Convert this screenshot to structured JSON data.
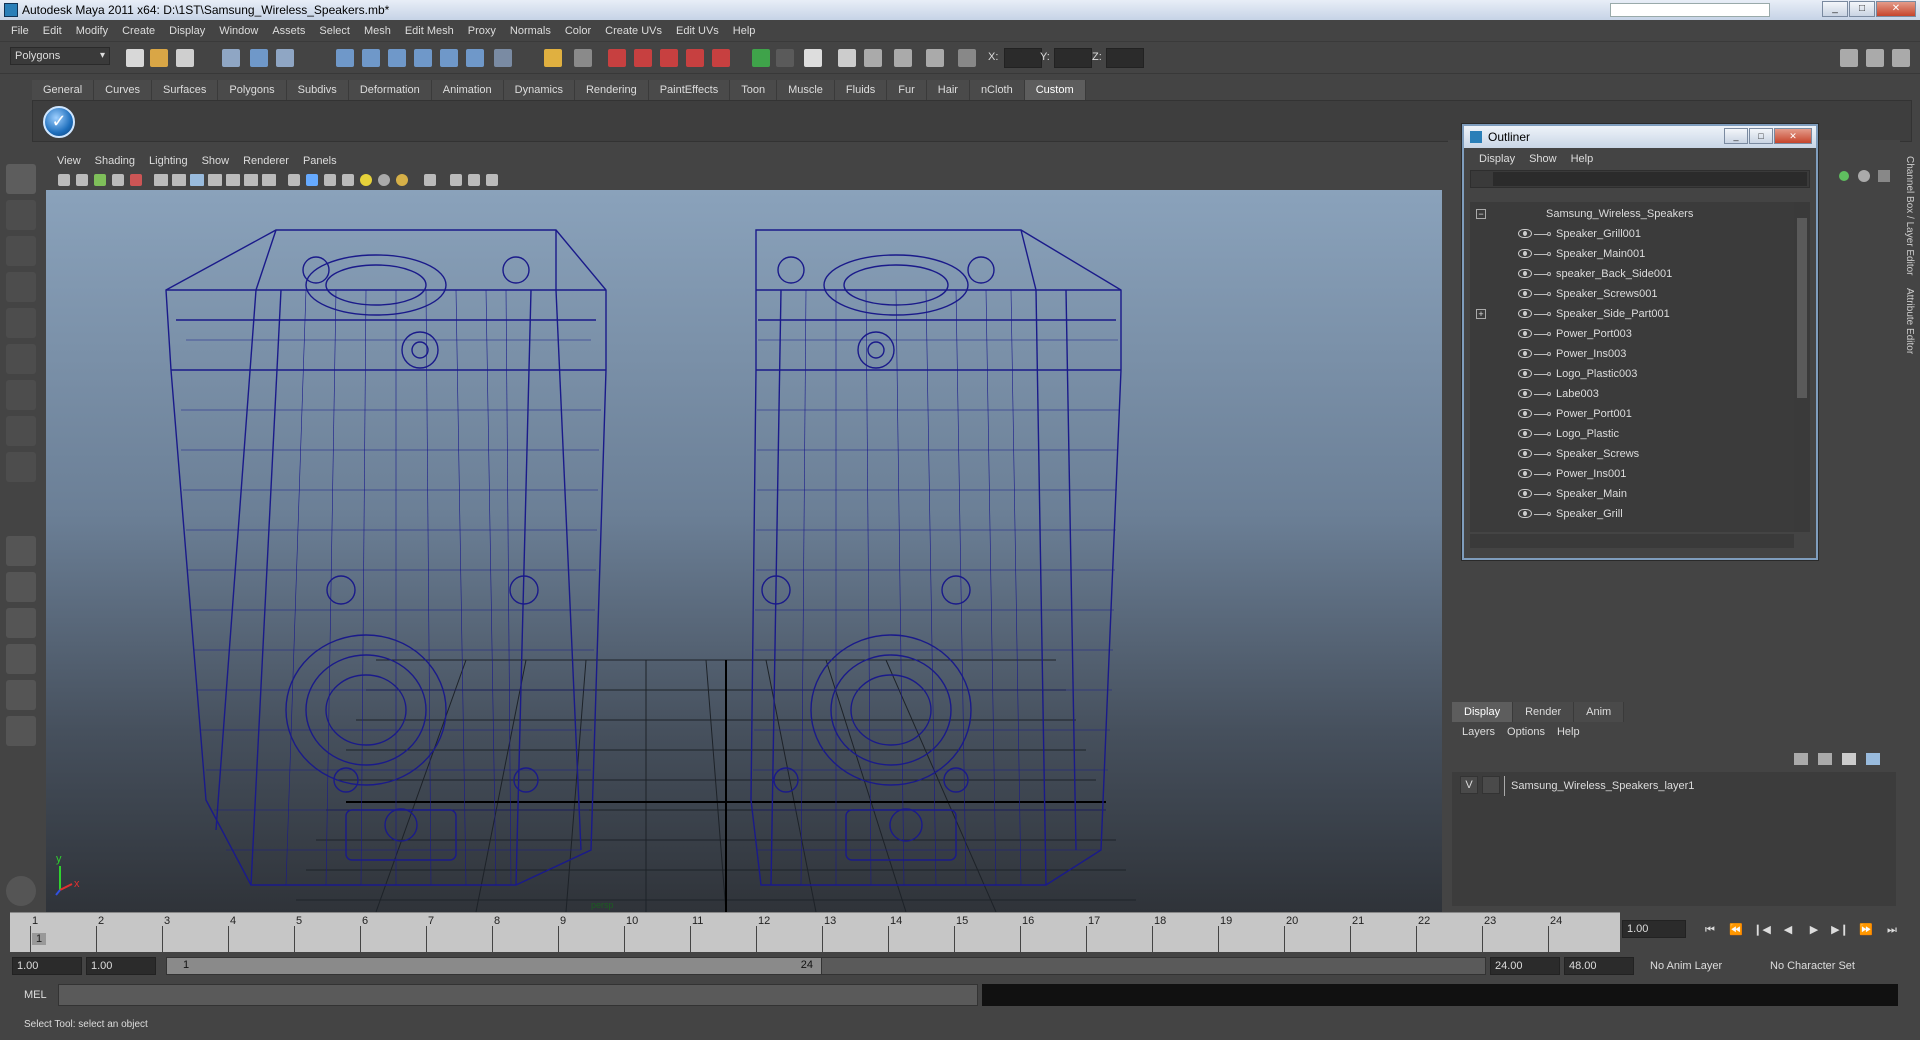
{
  "window": {
    "title": "Autodesk Maya 2011 x64: D:\\1ST\\Samsung_Wireless_Speakers.mb*"
  },
  "menubar": [
    "File",
    "Edit",
    "Modify",
    "Create",
    "Display",
    "Window",
    "Assets",
    "Select",
    "Mesh",
    "Edit Mesh",
    "Proxy",
    "Normals",
    "Color",
    "Create UVs",
    "Edit UVs",
    "Help"
  ],
  "status_line": {
    "mode": "Polygons",
    "x_label": "X:",
    "y_label": "Y:",
    "z_label": "Z:"
  },
  "shelf": {
    "tabs": [
      "General",
      "Curves",
      "Surfaces",
      "Polygons",
      "Subdivs",
      "Deformation",
      "Animation",
      "Dynamics",
      "Rendering",
      "PaintEffects",
      "Toon",
      "Muscle",
      "Fluids",
      "Fur",
      "Hair",
      "nCloth",
      "Custom"
    ],
    "active_tab": "Custom"
  },
  "viewport": {
    "menu": [
      "View",
      "Shading",
      "Lighting",
      "Show",
      "Renderer",
      "Panels"
    ],
    "camera_label": "persp",
    "axis_x": "x",
    "axis_y": "y",
    "wire_color": "#1a1a8a"
  },
  "outliner": {
    "title": "Outliner",
    "menu": [
      "Display",
      "Show",
      "Help"
    ],
    "root": "Samsung_Wireless_Speakers",
    "items": [
      "Speaker_Grill001",
      "Speaker_Main001",
      "speaker_Back_Side001",
      "Speaker_Screws001",
      "Speaker_Side_Part001",
      "Power_Port003",
      "Power_Ins003",
      "Logo_Plastic003",
      "Labe003",
      "Power_Port001",
      "Logo_Plastic",
      "Speaker_Screws",
      "Power_Ins001",
      "Speaker_Main",
      "Speaker_Grill"
    ]
  },
  "layer_editor": {
    "tabs": [
      "Display",
      "Render",
      "Anim"
    ],
    "active_tab": "Display",
    "menu": [
      "Layers",
      "Options",
      "Help"
    ],
    "layer": {
      "visible": "V",
      "name": "Samsung_Wireless_Speakers_layer1"
    }
  },
  "side_tabs": [
    "Channel Box / Layer Editor",
    "Attribute Editor"
  ],
  "timeline": {
    "ticks": [
      "1",
      "2",
      "3",
      "4",
      "5",
      "6",
      "7",
      "8",
      "9",
      "10",
      "11",
      "12",
      "13",
      "14",
      "15",
      "16",
      "17",
      "18",
      "19",
      "20",
      "21",
      "22",
      "23",
      "24"
    ],
    "current_frame": "1.00",
    "current_marker": "1"
  },
  "range": {
    "start_time": "1.00",
    "playback_start": "1.00",
    "slider_start": "1",
    "slider_end": "24",
    "playback_end": "24.00",
    "end_time": "48.00",
    "anim_layer": "No Anim Layer",
    "character_set": "No Character Set"
  },
  "command_line": {
    "label": "MEL"
  },
  "help_line": {
    "text": "Select Tool: select an object"
  }
}
